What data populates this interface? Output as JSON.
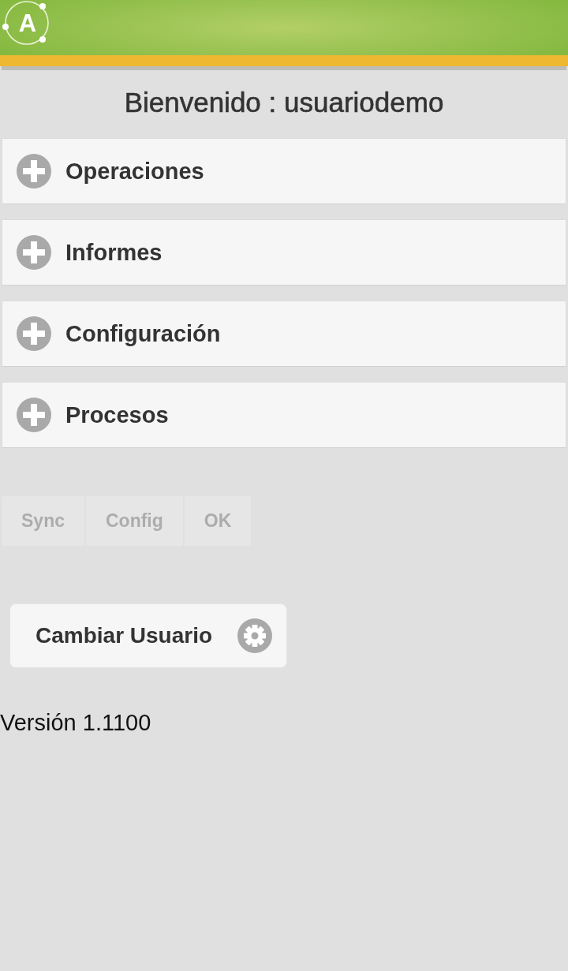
{
  "header": {
    "logo_letter": "A"
  },
  "welcome": "Bienvenido : usuariodemo",
  "sections": [
    {
      "label": "Operaciones",
      "expanded": false
    },
    {
      "label": "Informes",
      "expanded": false
    },
    {
      "label": "Configuración",
      "expanded": false
    },
    {
      "label": "Procesos",
      "expanded": false
    }
  ],
  "toolbar": [
    {
      "label": "Sync",
      "disabled": true
    },
    {
      "label": "Config",
      "disabled": true
    },
    {
      "label": "OK",
      "disabled": true
    }
  ],
  "change_user_button": {
    "label": "Cambiar Usuario"
  },
  "version": "Versión 1.1100"
}
